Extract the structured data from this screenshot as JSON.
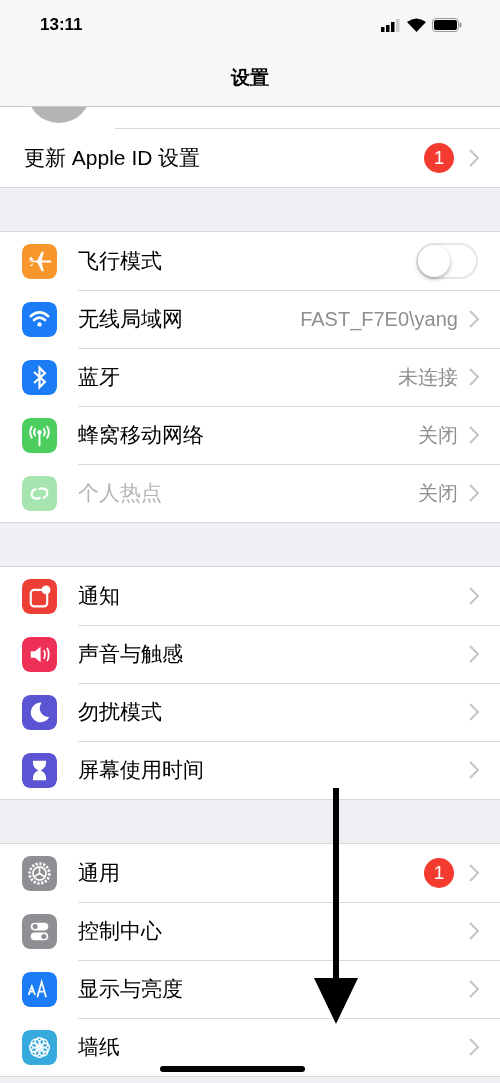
{
  "status_bar": {
    "time": "13:11"
  },
  "nav": {
    "title": "设置"
  },
  "sections": [
    {
      "rows": [
        {
          "label": "更新 Apple ID 设置",
          "kind": "chevron",
          "badge": "1",
          "disabled": false
        }
      ]
    },
    {
      "rows": [
        {
          "label": "飞行模式",
          "kind": "toggle",
          "on": false,
          "color": "#f8962e",
          "disabled": false
        },
        {
          "label": "无线局域网",
          "kind": "chevron",
          "value": "FAST_F7E0\\yang",
          "color": "#1b7cf5",
          "disabled": false
        },
        {
          "label": "蓝牙",
          "kind": "chevron",
          "value": "未连接",
          "color": "#1b7cf5",
          "disabled": false
        },
        {
          "label": "蜂窝移动网络",
          "kind": "chevron",
          "value": "关闭",
          "color": "#4bce5e",
          "disabled": false
        },
        {
          "label": "个人热点",
          "kind": "chevron",
          "value": "关闭",
          "color": "#a6e5b0",
          "disabled": true
        }
      ]
    },
    {
      "rows": [
        {
          "label": "通知",
          "kind": "chevron",
          "color": "#ee3f37",
          "disabled": false
        },
        {
          "label": "声音与触感",
          "kind": "chevron",
          "color": "#ee3056",
          "disabled": false
        },
        {
          "label": "勿扰模式",
          "kind": "chevron",
          "color": "#5b55d4",
          "disabled": false
        },
        {
          "label": "屏幕使用时间",
          "kind": "chevron",
          "color": "#5b55d4",
          "disabled": false
        }
      ]
    },
    {
      "rows": [
        {
          "label": "通用",
          "kind": "chevron",
          "badge": "1",
          "color": "#8e8e93",
          "disabled": false
        },
        {
          "label": "控制中心",
          "kind": "chevron",
          "color": "#8e8e93",
          "disabled": false
        },
        {
          "label": "显示与亮度",
          "kind": "chevron",
          "color": "#1b7cf5",
          "disabled": false
        },
        {
          "label": "墙纸",
          "kind": "chevron",
          "color": "#36aadc",
          "disabled": false
        }
      ]
    }
  ]
}
